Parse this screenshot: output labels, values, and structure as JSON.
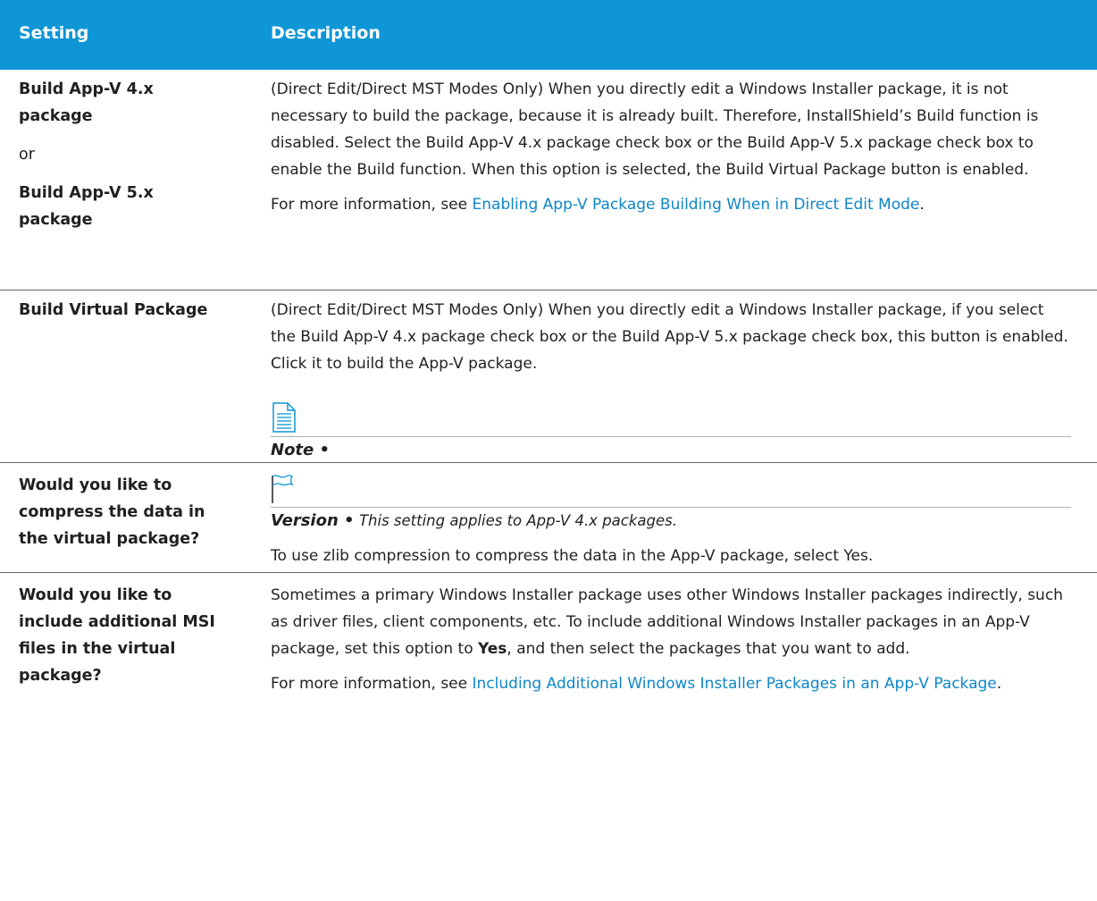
{
  "header": {
    "setting": "Setting",
    "description": "Description"
  },
  "rows": [
    {
      "setting_a": "Build App-V 4.x package",
      "or": "or",
      "setting_b": "Build App-V 5.x package",
      "para1": "(Direct Edit/Direct MST Modes Only) When you directly edit a Windows Installer package, it is not necessary to build the package, because it is already built. Therefore, InstallShield’s Build function is disabled. Select the Build App-V 4.x package check box or the Build App-V 5.x package check box to enable the Build function. When this option is selected, the Build Virtual Package button is enabled.",
      "para2_prefix": "For more information, see ",
      "para2_link": "Enabling App-V Package Building When in Direct Edit Mode",
      "para2_suffix": "."
    },
    {
      "setting": "Build Virtual Package",
      "para1": "(Direct Edit/Direct MST Modes Only) When you directly edit a Windows Installer package, if you select the Build App-V 4.x package check box or the Build App-V 5.x package check box, this button is enabled. Click it to build the App-V package.",
      "note_label": "Note •",
      "icon": "note-icon"
    },
    {
      "setting": "Would you like to compress the data in the virtual package?",
      "icon": "flag-icon",
      "version_label": "Version •",
      "version_text": "This setting applies to App-V 4.x packages.",
      "para1": "To use zlib compression to compress the data in the App-V package, select Yes."
    },
    {
      "setting": "Would you like to include additional MSI files in the virtual package?",
      "para1_a": "Sometimes a primary Windows Installer package uses other Windows Installer packages indirectly, such as driver files, client components, etc. To include additional Windows Installer packages in an App-V package, set this option to ",
      "para1_bold": "Yes",
      "para1_b": ", and then select the packages that you want to add.",
      "para2_prefix": "For more information, see ",
      "para2_link": "Including Additional Windows Installer Packages in an App-V Package",
      "para2_suffix": "."
    }
  ],
  "colors": {
    "header_bg": "#0e96d6",
    "link": "#0e86c8",
    "text": "#231f20"
  }
}
